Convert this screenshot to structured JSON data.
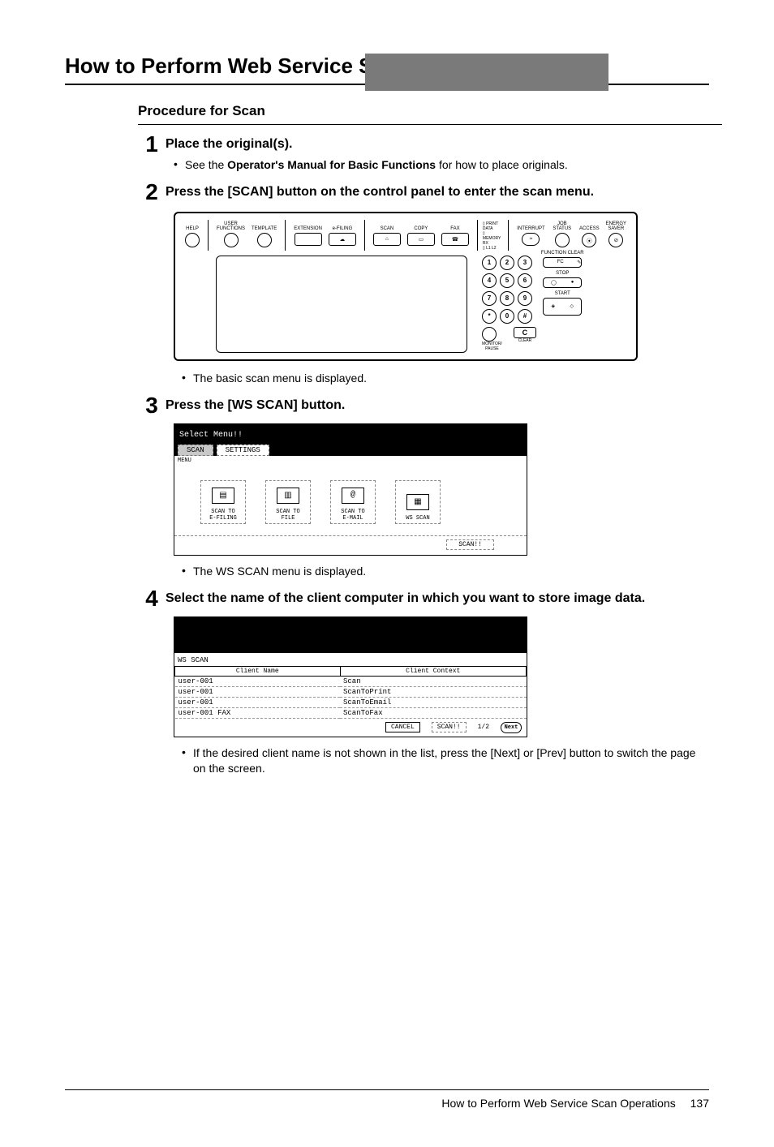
{
  "page_title": "How to Perform Web Service Scan Operations",
  "procedure_title": "Procedure for Scan",
  "steps": {
    "s1": {
      "num": "1",
      "head": "Place the original(s).",
      "bullet_pre": "See the ",
      "bullet_bold": "Operator's Manual for Basic Functions",
      "bullet_post": " for how to place originals."
    },
    "s2": {
      "num": "2",
      "head": "Press the [SCAN] button on the control panel to enter the scan menu.",
      "after": "The basic scan menu is displayed."
    },
    "s3": {
      "num": "3",
      "head": "Press the [WS SCAN] button.",
      "after": "The WS SCAN menu is displayed."
    },
    "s4": {
      "num": "4",
      "head": "Select the name of the client computer in which you want to store image data.",
      "after": "If the desired client name is not shown in the list, press the [Next] or [Prev] button to switch the page on the screen."
    }
  },
  "panel": {
    "help": "HELP",
    "user_functions": "USER\nFUNCTIONS",
    "template": "TEMPLATE",
    "extension": "EXTENSION",
    "efiling": "e-FILING",
    "scan": "SCAN",
    "copy": "COPY",
    "fax": "FAX",
    "print_data": "PRINT DATA",
    "memory_rx": "MEMORY RX",
    "lines": "L1    L2",
    "interrupt": "INTERRUPT",
    "job_status": "JOB STATUS",
    "access": "ACCESS",
    "energy_saver": "ENERGY\nSAVER",
    "function_clear": "FUNCTION CLEAR",
    "fc": "FC",
    "stop": "STOP",
    "start": "START",
    "c": "C",
    "monitor_pause": "MONITOR/\nPAUSE",
    "clear": "CLEAR",
    "keys": [
      "1",
      "2",
      "3",
      "4",
      "5",
      "6",
      "7",
      "8",
      "9",
      "*",
      "0",
      "#"
    ]
  },
  "scanmenu": {
    "title": "Select Menu!!",
    "tab_scan": "SCAN",
    "tab_settings": "SETTINGS",
    "menu_label": "MENU",
    "icons": {
      "efiling": "SCAN TO\nE-FILING",
      "file": "SCAN TO\nFILE",
      "email": "SCAN TO\nE-MAIL",
      "wsscan": "WS SCAN"
    },
    "scan_btn": "SCAN!!"
  },
  "wsscan": {
    "label": "WS SCAN",
    "col_client_name": "Client Name",
    "col_client_context": "Client Context",
    "rows": [
      {
        "name": "user-001",
        "context": "Scan"
      },
      {
        "name": "user-001",
        "context": "ScanToPrint"
      },
      {
        "name": "user-001",
        "context": "ScanToEmail"
      },
      {
        "name": "user-001   FAX",
        "context": "ScanToFax"
      }
    ],
    "cancel": "CANCEL",
    "scan": "SCAN!!",
    "page": "1/2",
    "next": "Next"
  },
  "footer": {
    "text": "How to Perform Web Service Scan Operations",
    "page": "137"
  }
}
